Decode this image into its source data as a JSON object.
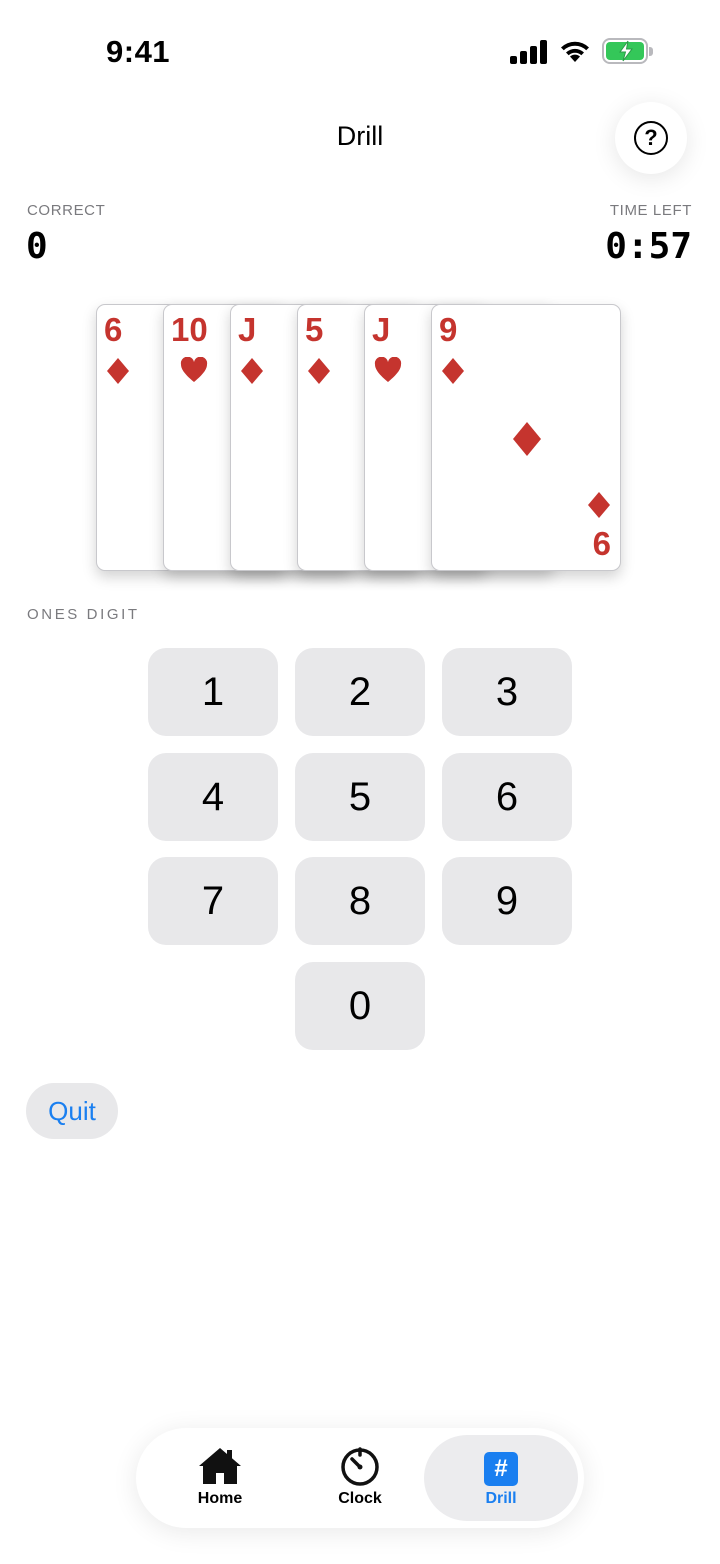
{
  "status_bar": {
    "time": "9:41"
  },
  "header": {
    "title": "Drill",
    "help_icon": "question-circle-icon"
  },
  "stats": {
    "correct_label": "CORRECT",
    "correct_value": "0",
    "time_left_label": "TIME LEFT",
    "time_left_value": "0:57"
  },
  "cards": [
    {
      "rank": "6",
      "suit": "diamond"
    },
    {
      "rank": "10",
      "suit": "heart"
    },
    {
      "rank": "J",
      "suit": "diamond"
    },
    {
      "rank": "5",
      "suit": "diamond"
    },
    {
      "rank": "J",
      "suit": "heart"
    },
    {
      "rank": "9",
      "suit": "diamond",
      "bottom_rank": "6"
    }
  ],
  "keypad": {
    "label": "ONES DIGIT",
    "keys": [
      "1",
      "2",
      "3",
      "4",
      "5",
      "6",
      "7",
      "8",
      "9",
      "0"
    ]
  },
  "quit_label": "Quit",
  "tabs": [
    {
      "label": "Home",
      "icon": "house-icon"
    },
    {
      "label": "Clock",
      "icon": "timer-icon"
    },
    {
      "label": "Drill",
      "icon": "hash-icon",
      "selected": true
    }
  ],
  "colors": {
    "accent": "#1a7ff0",
    "card_red": "#c5342e",
    "key_bg": "#e8e8ea",
    "battery": "#34c759"
  }
}
